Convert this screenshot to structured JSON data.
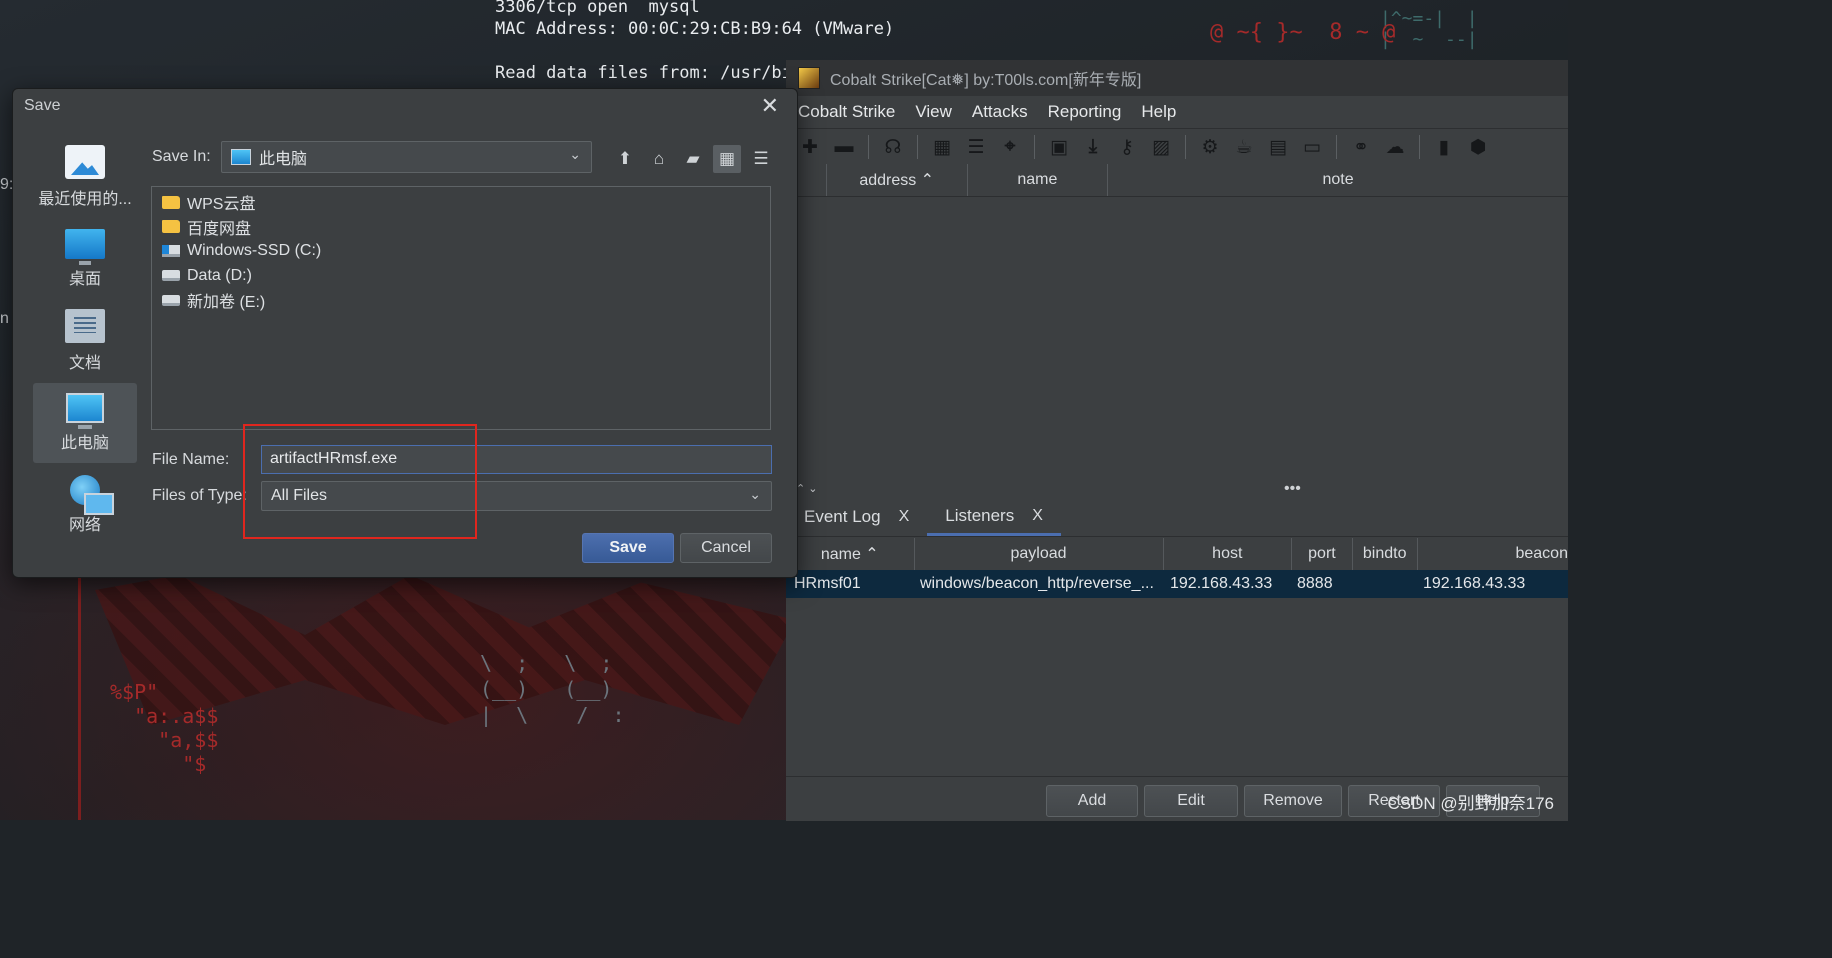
{
  "terminal": {
    "lines": [
      "3306/tcp open  mysql",
      "MAC Address: 00:0C:29:CB:B9:64 (VMware)",
      "",
      "Read data files from: /usr/bi"
    ]
  },
  "left_edge": {
    "char1": "9:",
    "char2": "n"
  },
  "cobalt": {
    "title": "Cobalt Strike[Cat❅] by:T00ls.com[新年专版]",
    "menu": [
      "Cobalt Strike",
      "View",
      "Attacks",
      "Reporting",
      "Help"
    ],
    "toolbar_icons": [
      "plus-icon",
      "minus-icon",
      "headphones-icon",
      "pivot-graph-icon",
      "list-icon",
      "target-icon",
      "credentials-icon",
      "download-icon",
      "key-icon",
      "screenshot-icon",
      "gear-icon",
      "coffee-icon",
      "document-icon",
      "console-icon",
      "link-icon",
      "cloud-icon",
      "book-icon",
      "package-icon"
    ],
    "targets_headers": [
      "address ⌃",
      "name",
      "note"
    ],
    "tabs": [
      {
        "label": "Event Log",
        "close": "X"
      },
      {
        "label": "Listeners",
        "close": "X"
      }
    ],
    "listener_headers": [
      "name ⌃",
      "payload",
      "host",
      "port",
      "bindto",
      "beacon"
    ],
    "listener_row": {
      "name": "HRmsf01",
      "payload": "windows/beacon_http/reverse_...",
      "host": "192.168.43.33",
      "port": "8888",
      "bindto": "",
      "beacon": "192.168.43.33"
    },
    "buttons": [
      "Add",
      "Edit",
      "Remove",
      "Restart",
      "Help"
    ],
    "splitter_dots": "•••",
    "splitter_arrows": "⌃ ⌄"
  },
  "watermark": "CSDN @别野加奈176",
  "dialog": {
    "title": "Save",
    "close": "✕",
    "places": [
      {
        "label": "最近使用的...",
        "icon": "recent-icon"
      },
      {
        "label": "桌面",
        "icon": "desktop-icon"
      },
      {
        "label": "文档",
        "icon": "documents-icon"
      },
      {
        "label": "此电脑",
        "icon": "this-pc-icon"
      },
      {
        "label": "网络",
        "icon": "network-icon"
      }
    ],
    "save_in_label": "Save In:",
    "save_in_value": "此电脑",
    "files": [
      {
        "name": "WPS云盘",
        "type": "folder"
      },
      {
        "name": "百度网盘",
        "type": "folder"
      },
      {
        "name": "Windows-SSD (C:)",
        "type": "sysdrive"
      },
      {
        "name": "Data (D:)",
        "type": "drive"
      },
      {
        "name": "新加卷 (E:)",
        "type": "drive"
      }
    ],
    "file_name_label": "File Name:",
    "file_name_value": "artifactHRmsf.exe",
    "files_of_type_label": "Files of Type:",
    "files_of_type_value": "All Files",
    "save_button": "Save",
    "cancel_button": "Cancel"
  },
  "colors": {
    "accent": "#4b6eaf",
    "highlight_box": "#e0261e",
    "selected_row": "#0d293e"
  }
}
